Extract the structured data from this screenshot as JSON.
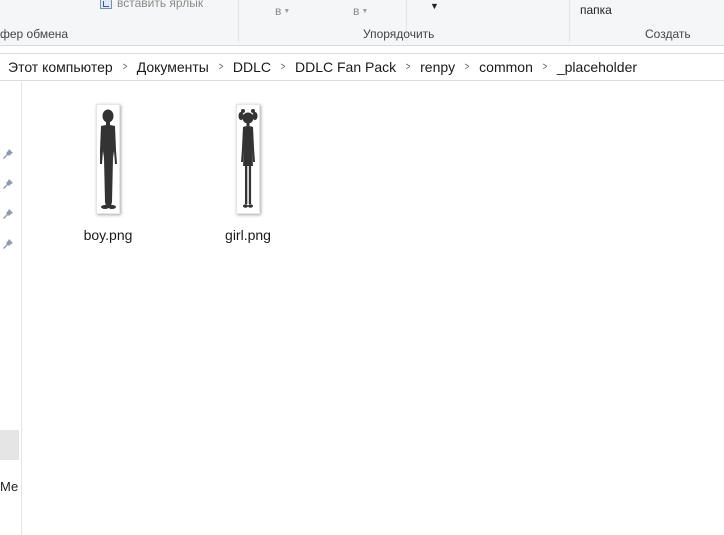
{
  "ribbon": {
    "shortcut_label": "вставить ярлык",
    "dropdown1": "в",
    "dropdown2": "в",
    "folder_label": "папка",
    "groups": {
      "clipboard": "фер обмена",
      "sort": "Упорядочить",
      "create": "Создать"
    }
  },
  "address": {
    "crumbs": [
      "Этот компьютер",
      "Документы",
      "DDLC",
      "DDLC Fan Pack",
      "renpy",
      "common",
      "_placeholder"
    ]
  },
  "nav": {
    "partial_label": "Ме",
    "pins": [
      "pin-icon",
      "pin-icon",
      "pin-icon",
      "pin-icon"
    ]
  },
  "files": [
    {
      "name": "boy.png",
      "icon": "boy-silhouette-thumbnail"
    },
    {
      "name": "girl.png",
      "icon": "girl-silhouette-thumbnail"
    }
  ],
  "colors": {
    "ribbon_bg": "#f5f6f7",
    "silhouette": "#333333",
    "selection": "#e5e5e5"
  }
}
